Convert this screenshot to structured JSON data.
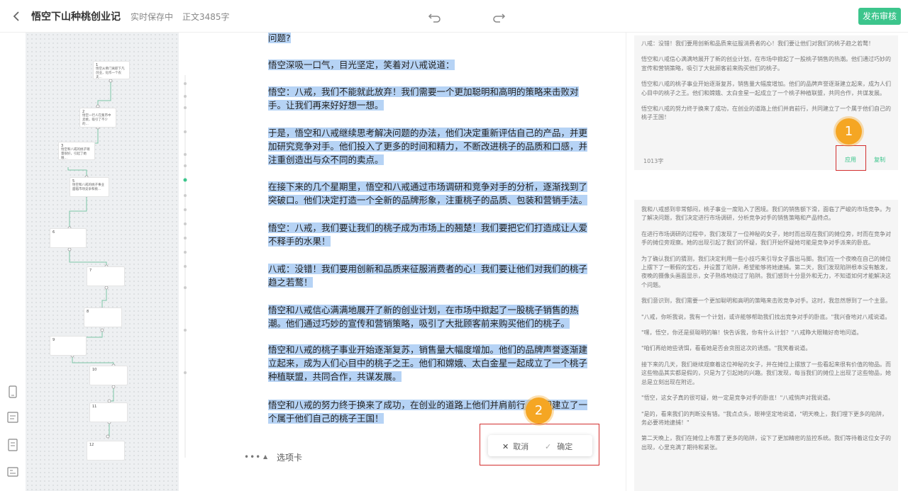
{
  "header": {
    "title": "悟空下山种桃创业记",
    "save_status": "实时保存中",
    "word_count": "正文3485字",
    "publish_label": "发布审核"
  },
  "outline": {
    "nodes": [
      {
        "num": "1",
        "text": "悟空从佛门离职下凡创业，化作一个农夫..."
      },
      {
        "num": "2",
        "text": "悟空一行人在集市中卖桃，吸引了不少的..."
      },
      {
        "num": "3",
        "text": "悟空和八戒的桃子销量很好，引起了她眼..."
      },
      {
        "num": "5",
        "text": "悟空和八戒的桃子事业面临市场竞争和挑..."
      },
      {
        "num": "6",
        "text": ""
      },
      {
        "num": "7",
        "text": ""
      },
      {
        "num": "8",
        "text": ""
      },
      {
        "num": "9",
        "text": ""
      },
      {
        "num": "10",
        "text": ""
      },
      {
        "num": "11",
        "text": ""
      },
      {
        "num": "12",
        "text": ""
      }
    ]
  },
  "editor": {
    "paragraphs": [
      "问题?",
      "悟空深吸一口气，目光坚定，笑着对八戒说道：",
      "悟空：八戒，我们不能就此放弃！我们需要一个更加聪明和高明的策略来击败对手。让我们再来好好想一想。",
      "于是，悟空和八戒继续思考解决问题的办法，他们决定重新评估自己的产品，并更加研究竞争对手。他们投入了更多的时间和精力，不断改进桃子的品质和口感，并注重创造出与众不同的卖点。",
      "在接下来的几个星期里，悟空和八戒通过市场调研和竞争对手的分析，逐渐找到了突破口。他们决定打造一个全新的品牌形象，注重桃子的品质、包装和营销手法。",
      "悟空：八戒，我们要让我们的桃子成为市场上的翘楚！我们要把它们打造成让人爱不释手的水果！",
      "八戒：没错！我们要用创新和品质来征服消费者的心！我们要让他们对我们的桃子趋之若鹜！",
      "悟空和八戒信心满满地展开了新的创业计划，在市场中掀起了一股桃子销售的热潮。他们通过巧妙的宣传和营销策略，吸引了大批顾客前来购买他们的桃子。",
      "悟空和八戒的桃子事业开始逐渐复苏，销售量大幅度增加。他们的品牌声誉逐渐建立起来，成为人们心目中的桃子之王。他们和嫦娥、太白金星一起成立了一个桃子种植联盟，共同合作，共谋发展。",
      "悟空和八戒的努力终于换来了成功，在创业的道路上他们并肩前行，共同建立了一个属于他们自己的桃子王国！"
    ],
    "tab_label": "选项卡",
    "cancel_label": "取消",
    "confirm_label": "确定"
  },
  "badges": {
    "one": "1",
    "two": "2"
  },
  "right_panel": {
    "card1": {
      "paragraphs": [
        "八戒：没错！我们要用创新和品质来征服消费者的心！我们要让他们对我们的桃子趋之若鹜！",
        "悟空和八戒信心满满地展开了新的创业计划，在市场中掀起了一股桃子销售的热潮。他们通过巧妙的宣传和营销策略，吸引了大批顾客前来购买他们的桃子。",
        "悟空和八戒的桃子事业开始逐渐复苏，销售量大幅度增加。他们的品牌声誉逐渐建立起来，成为人们心目中的桃子之王。他们和嫦娥、太白金星一起成立了一个桃子种植联盟，共同合作，共谋发展。",
        "悟空和八戒的努力终于换来了成功，在创业的道路上他们并肩前行，共同建立了一个属于他们自己的桃子王国！"
      ],
      "count": "1013字",
      "apply_label": "应用",
      "copy_label": "复制"
    },
    "card2": {
      "paragraphs": [
        "我和八戒感到非常郁闷，桃子事业一度陷入了困境。我们的销售额下滑，面临了严峻的市场竞争。为了解决问题，我们决定进行市场调研，分析竞争对手的销售策略和产品特点。",
        "在进行市场调研的过程中，我们发现了一位神秘的女子，她时而出现在我们的摊位旁，时而在竞争对手的摊位旁观察。她的出现引起了我们的怀疑，我们开始怀疑她可能是竞争对手派来的卧底。",
        "为了确认我们的猜测，我们决定利用一些小技巧来引导女子露出马脚。我们在一个夜晚在自己的摊位上摆下了一颗假的宝石，并设置了陷阱，希望能够将她逮捕。第二天，我们发现陷阱根本没有触发，夜晚的摄像头画面显示，女子熟练地绕过了陷阱。我们感到十分意外和无力，不知道如何才能解决这个问题。",
        "我们意识到，我们需要一个更加聪明和高明的策略来击败竞争对手。这时，我忽然想到了一个主意。",
        "\"八戒，你听我说，我有一个计划，或许能够帮助我们找出竞争对手的卧底。\"我兴奋地对八戒说道。",
        "\"嘿，悟空，你还是挺聪明的嘛！快告诉我，你有什么计划？\"八戒睁大眼睛好奇地问道。",
        "\"咱们再给她些诱饵，看看她是否会贪图这次的诱惑。\"我笑着说道。",
        "接下来的几天，我们继续观察着这位神秘的女子，并在摊位上摆放了一些看起来很有价值的物品。而这些物品其实都是假的，只是为了引起她的兴趣。我们发现，每当我们的摊位上出现了这些物品，她总是立刻出现在附近。",
        "\"悟空，这女子真的很可疑，她一定是竞争对手的卧底！\"八戒悄声对我说道。",
        "\"是的，看来我们的判断没有错。\"我点点头，眼神坚定地说道，\"明天晚上，我们埋下更多的陷阱，务必要将她逮捕！\"",
        "第二天晚上，我们在摊位上布置了更多的陷阱，设下了更加精密的监控系统。我们等待着这位女子的出现，心里充满了期待和紧张。"
      ]
    }
  },
  "rail_icons": [
    "phone-icon",
    "outline-icon",
    "document-icon",
    "card-icon"
  ]
}
